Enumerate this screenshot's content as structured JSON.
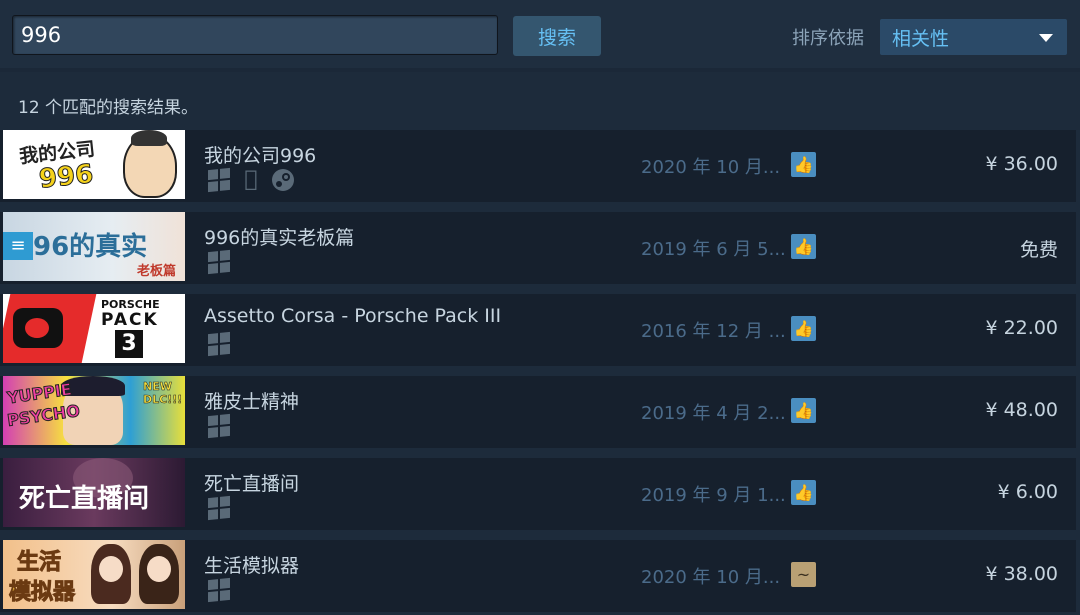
{
  "search": {
    "value": "996",
    "button_label": "搜索"
  },
  "sort": {
    "label": "排序依据",
    "value": "相关性"
  },
  "result_count": "12 个匹配的搜索结果。",
  "results": [
    {
      "title": "我的公司996",
      "thumb_text": [
        "我的公司",
        "996"
      ],
      "platforms": [
        "windows-icon",
        "apple-icon",
        "steam-icon"
      ],
      "date": "2020 年 10 月...",
      "review": "positive",
      "review_icon": "thumbs-up-icon",
      "price": "¥ 36.00"
    },
    {
      "title": "996的真实老板篇",
      "thumb_text": [
        "96的真实",
        "老板篇"
      ],
      "platforms": [
        "windows-icon"
      ],
      "date": "2019 年 6 月 5...",
      "review": "positive",
      "review_icon": "thumbs-up-icon",
      "price": "免费"
    },
    {
      "title": "Assetto Corsa - Porsche Pack III",
      "thumb_text": [
        "PORSCHE",
        "PACK",
        "3"
      ],
      "platforms": [
        "windows-icon"
      ],
      "date": "2016 年 12 月 ...",
      "review": "positive",
      "review_icon": "thumbs-up-icon",
      "price": "¥ 22.00"
    },
    {
      "title": "雅皮士精神",
      "thumb_text": [
        "YUPPIE",
        "PSYCHO",
        "NEW DLC!!!"
      ],
      "platforms": [
        "windows-icon"
      ],
      "date": "2019 年 4 月 2...",
      "review": "positive",
      "review_icon": "thumbs-up-icon",
      "price": "¥ 48.00"
    },
    {
      "title": "死亡直播间",
      "thumb_text": [
        "死亡直播间"
      ],
      "platforms": [
        "windows-icon"
      ],
      "date": "2019 年 9 月 1...",
      "review": "positive",
      "review_icon": "thumbs-up-icon",
      "price": "¥ 6.00"
    },
    {
      "title": "生活模拟器",
      "thumb_text": [
        "生活",
        "模拟器"
      ],
      "platforms": [
        "windows-icon"
      ],
      "date": "2020 年 10 月...",
      "review": "mixed",
      "review_icon": "mixed-review-icon",
      "price": "¥ 38.00"
    }
  ],
  "colors": {
    "background": "#1b2838",
    "accent": "#66c0f4",
    "positive_review": "#4a8ec0",
    "mixed_review": "#b9a074"
  }
}
